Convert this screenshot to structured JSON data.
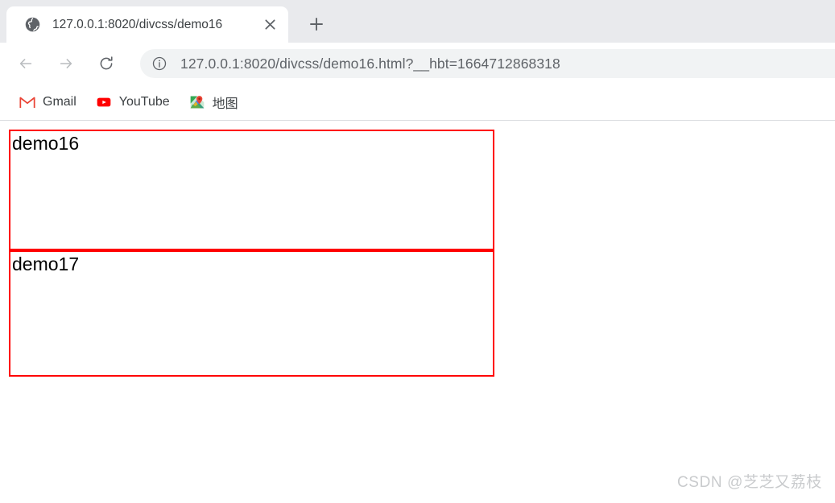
{
  "browser": {
    "tab": {
      "favicon": "globe-icon",
      "title": "127.0.0.1:8020/divcss/demo16",
      "close_label": "✕"
    },
    "new_tab_label": "+",
    "toolbar": {
      "back_label": "←",
      "forward_label": "→",
      "reload_label": "⟳",
      "site_info_icon": "info-circle-icon",
      "url": "127.0.0.1:8020/divcss/demo16.html?__hbt=1664712868318"
    },
    "bookmarks": [
      {
        "label": "Gmail",
        "icon": "gmail-icon"
      },
      {
        "label": "YouTube",
        "icon": "youtube-icon"
      },
      {
        "label": "地图",
        "icon": "google-maps-icon"
      }
    ]
  },
  "page": {
    "boxes": [
      {
        "text": "demo16",
        "border_color": "#ff0000"
      },
      {
        "text": "demo17",
        "border_color": "#ff0000"
      }
    ],
    "watermark": "CSDN @芝芝又荔枝"
  }
}
